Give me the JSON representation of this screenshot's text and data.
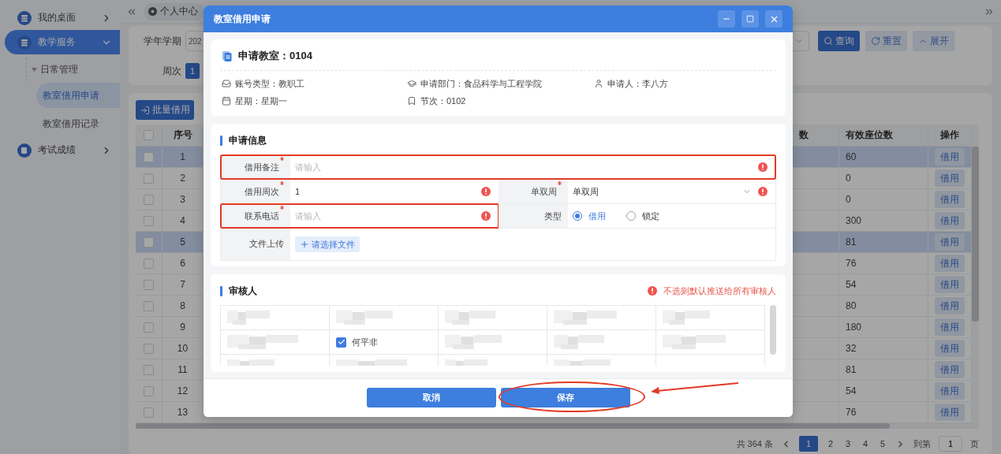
{
  "sidebar": {
    "items": [
      {
        "label": "我的桌面",
        "selected": false,
        "expanded": false
      },
      {
        "label": "教学服务",
        "selected": true,
        "expanded": true,
        "children": [
          {
            "label": "日常管理",
            "expanded": true,
            "children": [
              {
                "label": "教室借用申请",
                "selected": true
              },
              {
                "label": "教室借用记录",
                "selected": false
              }
            ]
          }
        ]
      },
      {
        "label": "考试成绩",
        "selected": false,
        "expanded": false
      }
    ]
  },
  "tabs": [
    {
      "label": "个人中心"
    }
  ],
  "filters": {
    "term": {
      "label": "学年学期",
      "value": "202"
    },
    "week": {
      "label": "周次",
      "options": [
        {
          "label": "1",
          "selected": true
        }
      ]
    },
    "buttons": [
      {
        "label": "查询",
        "kind": "search"
      },
      {
        "label": "重置",
        "kind": "reset"
      },
      {
        "label": "展开",
        "kind": "expand"
      }
    ]
  },
  "toolbar": {
    "buttons": [
      {
        "label": "批量借用"
      }
    ]
  },
  "table": {
    "all_checked": false,
    "columns": [
      "序号",
      "数",
      "有效座位数",
      "操作"
    ],
    "rows": [
      {
        "index": "1",
        "seats": "60",
        "action": "借用",
        "checked": false,
        "highlighted": true
      },
      {
        "index": "2",
        "seats": "0",
        "action": "借用",
        "checked": false,
        "highlighted": false
      },
      {
        "index": "3",
        "seats": "0",
        "action": "借用",
        "checked": false,
        "highlighted": false
      },
      {
        "index": "4",
        "seats": "300",
        "action": "借用",
        "checked": false,
        "highlighted": false
      },
      {
        "index": "5",
        "seats": "81",
        "action": "借用",
        "checked": false,
        "highlighted": true
      },
      {
        "index": "6",
        "seats": "76",
        "action": "借用",
        "checked": false,
        "highlighted": false
      },
      {
        "index": "7",
        "seats": "54",
        "action": "借用",
        "checked": false,
        "highlighted": false
      },
      {
        "index": "8",
        "seats": "80",
        "action": "借用",
        "checked": false,
        "highlighted": false
      },
      {
        "index": "9",
        "seats": "180",
        "action": "借用",
        "checked": false,
        "highlighted": false
      },
      {
        "index": "10",
        "seats": "32",
        "action": "借用",
        "checked": false,
        "highlighted": false
      },
      {
        "index": "11",
        "seats": "81",
        "action": "借用",
        "checked": false,
        "highlighted": false
      },
      {
        "index": "12",
        "seats": "54",
        "action": "借用",
        "checked": false,
        "highlighted": false
      },
      {
        "index": "13",
        "seats": "76",
        "action": "借用",
        "checked": false,
        "highlighted": false
      }
    ]
  },
  "pagination": {
    "total": "共 364 条",
    "pages": [
      {
        "label": "1",
        "selected": true
      },
      {
        "label": "2",
        "selected": false
      },
      {
        "label": "3",
        "selected": false
      },
      {
        "label": "4",
        "selected": false
      },
      {
        "label": "5",
        "selected": false
      }
    ],
    "goto_label": "到第",
    "goto_value": "1",
    "suffix": "页"
  },
  "dialog": {
    "title": "教室借用申请",
    "room": {
      "title": "申请教室：0104",
      "details": [
        {
          "text": "账号类型：教职工"
        },
        {
          "text": "申请部门：食品科学与工程学院"
        },
        {
          "text": "申请人：李八方"
        },
        {
          "text": "星期：星期一"
        },
        {
          "text": "节次：0102"
        }
      ]
    },
    "form": {
      "title": "申请信息",
      "rows": [
        {
          "fields": [
            {
              "label": "借用备注",
              "kind": "input",
              "required": true,
              "placeholder": "请输入",
              "error": true,
              "highlighted": true
            }
          ]
        },
        {
          "fields": [
            {
              "label": "借用周次",
              "kind": "input",
              "required": true,
              "value": "1",
              "error": true,
              "highlighted": false
            },
            {
              "label": "单双周",
              "kind": "select",
              "required": true,
              "value": "单双周",
              "error": true,
              "highlighted": false
            }
          ]
        },
        {
          "fields": [
            {
              "label": "联系电话",
              "kind": "input",
              "required": true,
              "placeholder": "请输入",
              "error": true,
              "highlighted": true
            },
            {
              "label": "类型",
              "kind": "radio",
              "required": false,
              "error": false,
              "highlighted": false,
              "options": [
                {
                  "label": "借用",
                  "selected": true
                },
                {
                  "label": "锁定",
                  "selected": false
                }
              ]
            }
          ]
        },
        {
          "fields": [
            {
              "label": "文件上传",
              "kind": "upload",
              "required": false,
              "error": false,
              "highlighted": false,
              "button": "请选择文件"
            }
          ]
        }
      ]
    },
    "reviewers": {
      "title": "审核人",
      "hint": "不选则默认推送给所有审核人",
      "rows": [
        [
          {
            "kind": "blurred"
          },
          {
            "kind": "blurred"
          },
          {
            "kind": "blurred"
          },
          {
            "kind": "blurred"
          },
          {
            "kind": "blurred"
          }
        ],
        [
          {
            "kind": "blurred"
          },
          {
            "kind": "person",
            "name": "何平非",
            "checked": true
          },
          {
            "kind": "blurred"
          },
          {
            "kind": "blurred"
          },
          {
            "kind": "blurred"
          }
        ],
        [
          {
            "kind": "blurred"
          },
          {
            "kind": "blurred"
          },
          {
            "kind": "blurred"
          },
          {
            "kind": "blurred"
          },
          {
            "kind": "empty"
          }
        ]
      ]
    },
    "buttons": [
      {
        "label": "取消",
        "circled": false
      },
      {
        "label": "保存",
        "circled": true
      }
    ]
  }
}
